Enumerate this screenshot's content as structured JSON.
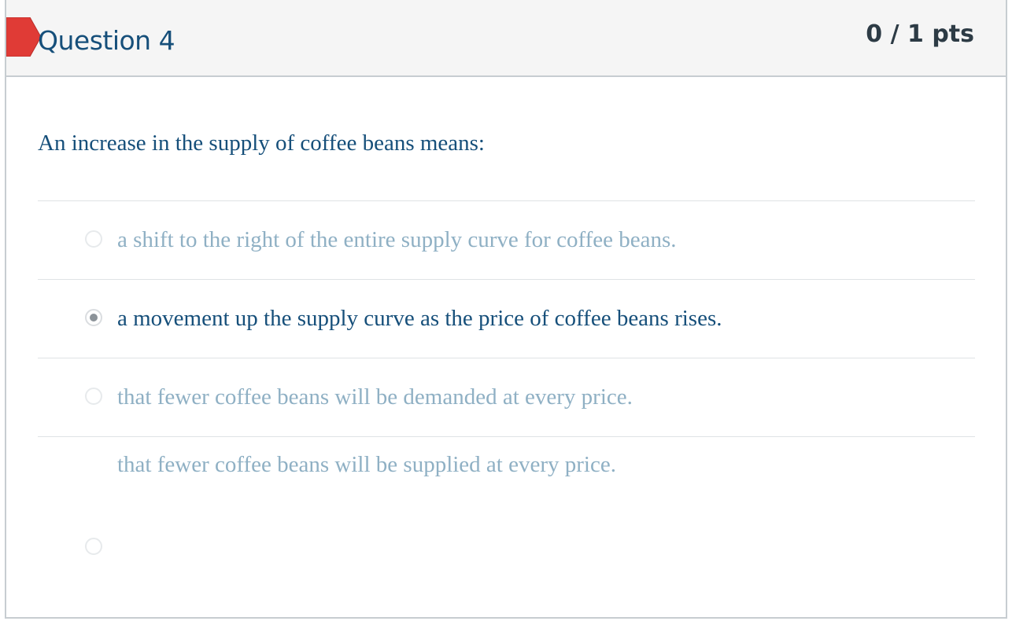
{
  "question": {
    "title": "Question 4",
    "points": "0 / 1 pts",
    "status": "incorrect",
    "flag_color": "#e03b36",
    "text": "An increase in the supply of coffee beans means:"
  },
  "answers": [
    {
      "label": "a shift to the right of the entire supply curve for coffee beans.",
      "selected": false
    },
    {
      "label": "a movement up the supply curve as the price of coffee beans rises.",
      "selected": true
    },
    {
      "label": "that fewer coffee beans will be demanded at every price.",
      "selected": false
    },
    {
      "label": "that fewer coffee beans will be supplied at every price.",
      "selected": false
    }
  ],
  "colors": {
    "title": "#164f7a",
    "unselected_answer": "#8fb0c4",
    "selected_answer": "#164f7a",
    "header_bg": "#f5f5f5"
  }
}
